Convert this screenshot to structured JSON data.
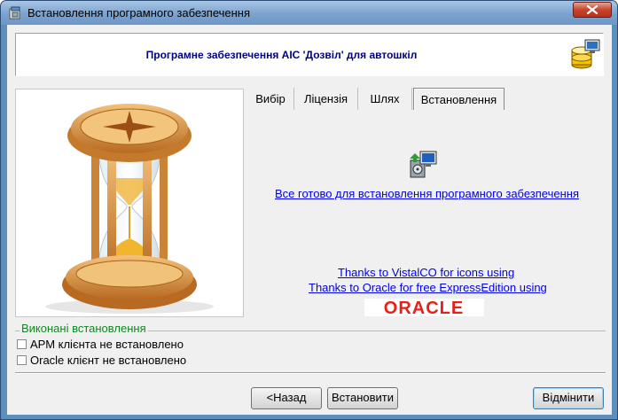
{
  "window": {
    "title": "Встановлення програмного забезпечення"
  },
  "header": {
    "title": "Програмне забезпечення АІС 'Дозвіл' для автошкіл",
    "icon": "database-setup-icon"
  },
  "left_panel": {
    "image": "hourglass-image"
  },
  "tabs": [
    {
      "label": "Вибір",
      "active": false
    },
    {
      "label": "Ліцензія",
      "active": false
    },
    {
      "label": "Шлях",
      "active": false
    },
    {
      "label": "Встановлення",
      "active": true
    }
  ],
  "install": {
    "icon": "installer-icon",
    "ready_link": "Все готово для встановлення програмного забезпечення",
    "thanks_vistalco": "Thanks to VistalCO for icons using",
    "thanks_oracle": "Thanks to Oracle for free ExpressEdition using",
    "oracle_logo_text": "ORACLE"
  },
  "completed_group": {
    "label": "Виконані встановлення",
    "items": [
      {
        "label": "АРМ клієнта не встановлено",
        "checked": false
      },
      {
        "label": "Oracle клієнт не встановлено",
        "checked": false
      }
    ]
  },
  "buttons": {
    "back": "<Назад",
    "install": "Встановити",
    "cancel": "Відмінити"
  },
  "colors": {
    "titlebar": "#7aa3cf",
    "header_title": "#000080",
    "link": "#0000ee",
    "group_label": "#0c8a1e",
    "oracle_red": "#e2231a"
  }
}
